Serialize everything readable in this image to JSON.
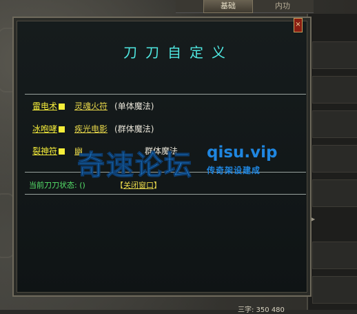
{
  "top_tabs": {
    "active": "基础",
    "inactive": "内功"
  },
  "dialog": {
    "title": "刀刀自定义",
    "close_glyph": "×",
    "rows": [
      {
        "spell": "雷电术",
        "key": "灵魂火符",
        "type": "(单体魔法)"
      },
      {
        "spell": "冰咆哮",
        "key": "疾光电影",
        "type": "(群体魔法)"
      },
      {
        "spell": "裂神符",
        "key": "幽",
        "type": "群体魔法"
      }
    ],
    "status_label": "当前刀刀状态: ()",
    "close_window_open": "【",
    "close_window_label": "关闭窗口",
    "close_window_close": "】"
  },
  "watermark": {
    "main": "奇速论坛",
    "url": "qisu.vip",
    "sub": "传奇架设建成"
  },
  "hud": {
    "coords": "三字: 350 480"
  },
  "colors": {
    "title": "#4fe7e0",
    "spell": "#f6ee3a",
    "status": "#56e36a",
    "watermark": "#1f86e0"
  }
}
